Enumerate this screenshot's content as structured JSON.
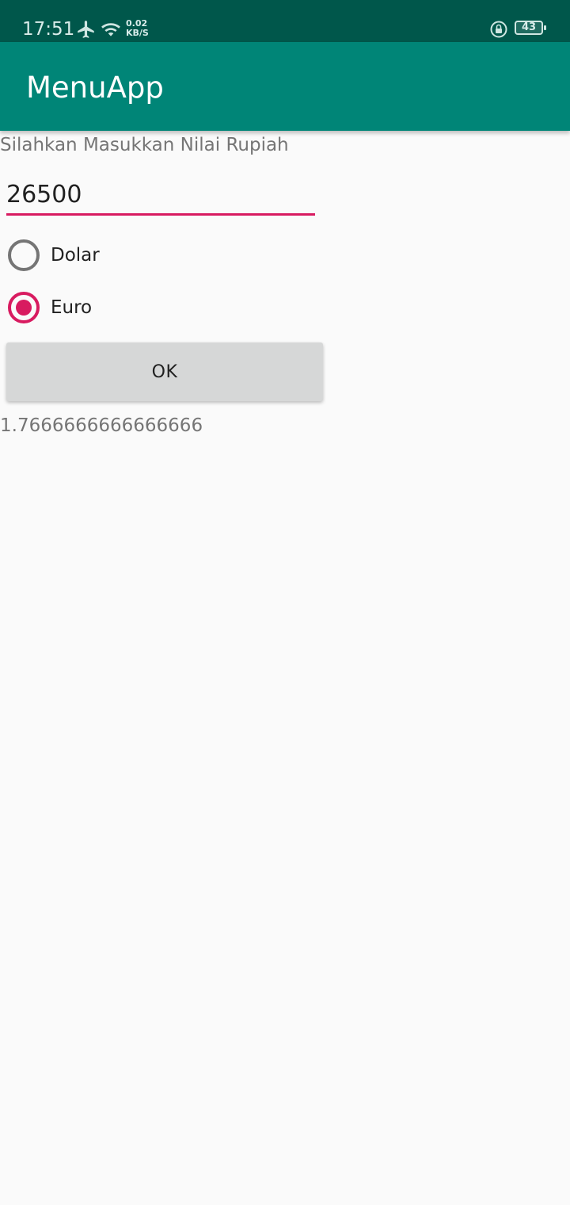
{
  "status_bar": {
    "time": "17:51",
    "net_speed_value": "0.02",
    "net_speed_unit": "KB/S",
    "battery_level": "43",
    "icons": [
      "airplane-icon",
      "wifi-icon",
      "rotation-lock-icon",
      "battery-icon"
    ]
  },
  "app_bar": {
    "title": "MenuApp"
  },
  "form": {
    "prompt": "Silahkan Masukkan Nilai Rupiah",
    "amount_value": "26500",
    "currency_options": [
      {
        "label": "Dolar",
        "selected": false
      },
      {
        "label": "Euro",
        "selected": true
      }
    ],
    "ok_label": "OK",
    "result": "1.7666666666666666"
  },
  "colors": {
    "status_bar": "#00574b",
    "app_bar": "#008577",
    "accent": "#d81b60",
    "background": "#fafafa"
  }
}
